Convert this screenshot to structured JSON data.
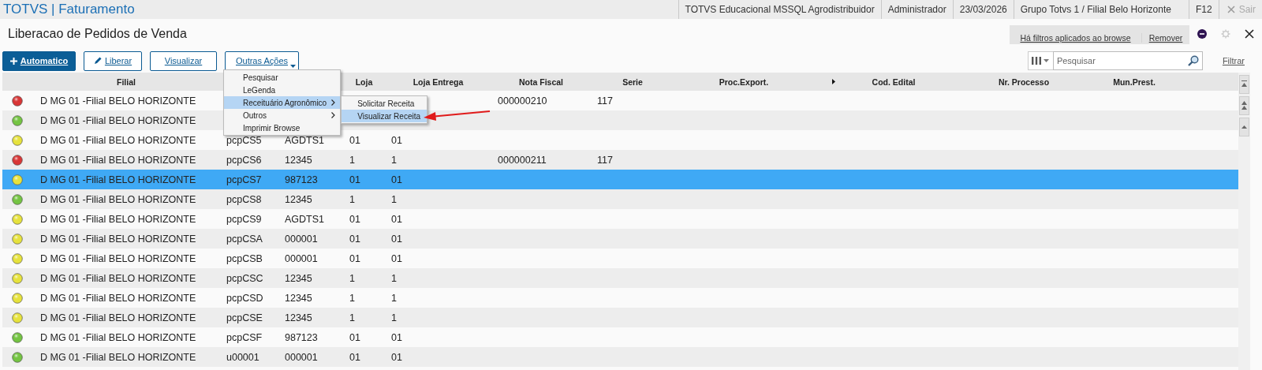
{
  "app_bar": {
    "title": "TOTVS | Faturamento",
    "info": [
      "TOTVS Educacional MSSQL Agrodistribuidor",
      "Administrador",
      "23/03/2026",
      "Grupo Totvs 1 / Filial Belo Horizonte"
    ],
    "shortcut": "F12",
    "exit": {
      "label": "Sair",
      "disabled": true
    }
  },
  "page": {
    "title": "Liberacao de Pedidos de Venda",
    "filter_notice": "Há filtros aplicados ao browse",
    "filter_action": "Remover",
    "settings_disabled": true
  },
  "actions": [
    {
      "label": "Automatico",
      "kind": "primary"
    },
    {
      "label": "Liberar",
      "kind": "edit"
    },
    {
      "label": "Visualizar",
      "kind": "plain"
    },
    {
      "label": "Outras Ações",
      "kind": "dropdown"
    }
  ],
  "search": {
    "placeholder": "Pesquisar"
  },
  "filter_link": "Filtrar",
  "table": {
    "columns": [
      "Filial",
      "",
      "",
      "Loja",
      "Loja Entrega",
      "Nota Fiscal",
      "Serie",
      "Proc.Export.",
      "Cod. Edital",
      "Nr. Processo",
      "Mun.Prest."
    ],
    "rows": [
      {
        "color": "#d93636",
        "selected": false,
        "cells": [
          "D MG 01 -Filial BELO HORIZONTE",
          null,
          null,
          null,
          null,
          "000000210",
          "117"
        ]
      },
      {
        "color": "#74c442",
        "selected": false,
        "cells": [
          "D MG 01 -Filial BELO HORIZONTE",
          null,
          null,
          null,
          null,
          null,
          null
        ]
      },
      {
        "color": "#e6e23c",
        "selected": false,
        "cells": [
          "D MG 01 -Filial BELO HORIZONTE",
          "pcpCS5",
          "AGDTS1",
          "01",
          "01",
          null,
          null
        ]
      },
      {
        "color": "#d93636",
        "selected": false,
        "cells": [
          "D MG 01 -Filial BELO HORIZONTE",
          "pcpCS6",
          "12345",
          "1",
          "1",
          "000000211",
          "117"
        ]
      },
      {
        "color": "#e6e23c",
        "selected": true,
        "cells": [
          "D MG 01 -Filial BELO HORIZONTE",
          "pcpCS7",
          "987123",
          "01",
          "01",
          null,
          null
        ]
      },
      {
        "color": "#74c442",
        "selected": false,
        "cells": [
          "D MG 01 -Filial BELO HORIZONTE",
          "pcpCS8",
          "12345",
          "1",
          "1",
          null,
          null
        ]
      },
      {
        "color": "#e6e23c",
        "selected": false,
        "cells": [
          "D MG 01 -Filial BELO HORIZONTE",
          "pcpCS9",
          "AGDTS1",
          "01",
          "01",
          null,
          null
        ]
      },
      {
        "color": "#e6e23c",
        "selected": false,
        "cells": [
          "D MG 01 -Filial BELO HORIZONTE",
          "pcpCSA",
          "000001",
          "01",
          "01",
          null,
          null
        ]
      },
      {
        "color": "#e6e23c",
        "selected": false,
        "cells": [
          "D MG 01 -Filial BELO HORIZONTE",
          "pcpCSB",
          "000001",
          "01",
          "01",
          null,
          null
        ]
      },
      {
        "color": "#e6e23c",
        "selected": false,
        "cells": [
          "D MG 01 -Filial BELO HORIZONTE",
          "pcpCSC",
          "12345",
          "1",
          "1",
          null,
          null
        ]
      },
      {
        "color": "#e6e23c",
        "selected": false,
        "cells": [
          "D MG 01 -Filial BELO HORIZONTE",
          "pcpCSD",
          "12345",
          "1",
          "1",
          null,
          null
        ]
      },
      {
        "color": "#e6e23c",
        "selected": false,
        "cells": [
          "D MG 01 -Filial BELO HORIZONTE",
          "pcpCSE",
          "12345",
          "1",
          "1",
          null,
          null
        ]
      },
      {
        "color": "#74c442",
        "selected": false,
        "cells": [
          "D MG 01 -Filial BELO HORIZONTE",
          "pcpCSF",
          "987123",
          "01",
          "01",
          null,
          null
        ]
      },
      {
        "color": "#74c442",
        "selected": false,
        "cells": [
          "D MG 01 -Filial BELO HORIZONTE",
          "u00001",
          "000001",
          "01",
          "01",
          null,
          null
        ]
      }
    ]
  },
  "context_menu": {
    "items": [
      {
        "label": "Pesquisar",
        "selected": false,
        "has_submenu": false
      },
      {
        "label": "LeGenda",
        "selected": false,
        "has_submenu": false
      },
      {
        "label": "Receituário Agronômico",
        "selected": true,
        "has_submenu": true
      },
      {
        "label": "Outros",
        "selected": false,
        "has_submenu": true
      },
      {
        "label": "Imprimir Browse",
        "selected": false,
        "has_submenu": false
      }
    ],
    "submenu": [
      {
        "label": "Solicitar Receita",
        "selected": false
      },
      {
        "label": "Visualizar Receita",
        "selected": true
      }
    ]
  }
}
